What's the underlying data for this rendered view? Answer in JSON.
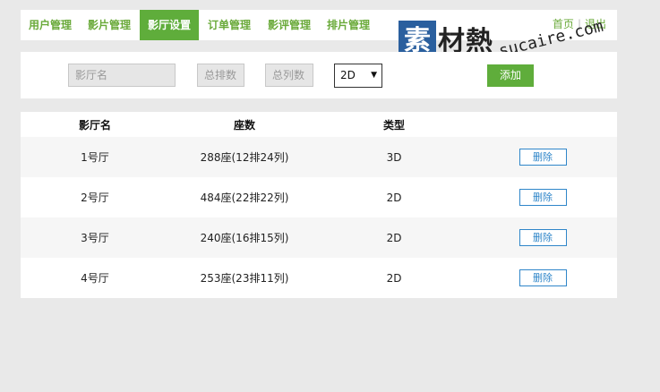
{
  "nav": {
    "items": [
      {
        "label": "用户管理",
        "active": false
      },
      {
        "label": "影片管理",
        "active": false
      },
      {
        "label": "影厅设置",
        "active": true
      },
      {
        "label": "订单管理",
        "active": false
      },
      {
        "label": "影评管理",
        "active": false
      },
      {
        "label": "排片管理",
        "active": false
      }
    ],
    "home": "首页",
    "separator": "|",
    "logout": "退出"
  },
  "watermark": {
    "box_char": "素",
    "chars": "材熱",
    "url": "sucaire.com"
  },
  "form": {
    "hall_name_placeholder": "影厅名",
    "rows_placeholder": "总排数",
    "cols_placeholder": "总列数",
    "type_selected": "2D",
    "add_label": "添加"
  },
  "table": {
    "headers": [
      "影厅名",
      "座数",
      "类型",
      ""
    ],
    "rows": [
      {
        "name": "1号厅",
        "seats": "288座(12排24列)",
        "type": "3D",
        "action": "删除"
      },
      {
        "name": "2号厅",
        "seats": "484座(22排22列)",
        "type": "2D",
        "action": "删除"
      },
      {
        "name": "3号厅",
        "seats": "240座(16排15列)",
        "type": "2D",
        "action": "删除"
      },
      {
        "name": "4号厅",
        "seats": "253座(23排11列)",
        "type": "2D",
        "action": "删除"
      }
    ]
  },
  "colors": {
    "accent_green": "#5fad3b",
    "link_blue": "#2f86c9",
    "background": "#e9e9e9"
  }
}
